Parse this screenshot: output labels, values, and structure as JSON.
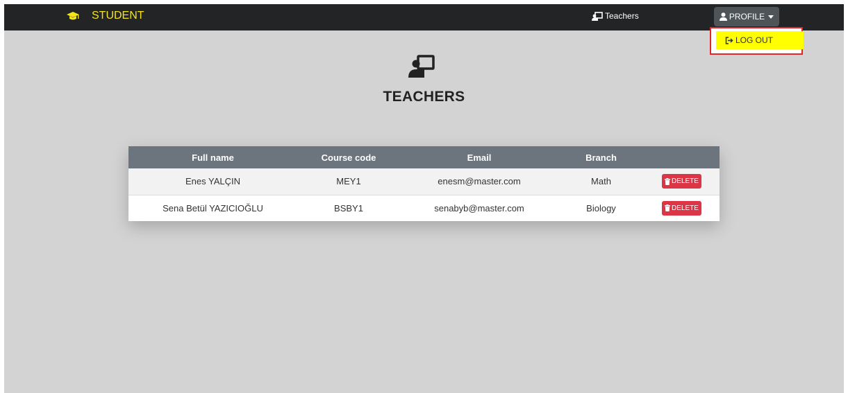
{
  "navbar": {
    "brand_label": "STUDENT",
    "brand_icon": "graduation-cap-icon",
    "teachers_link": "Teachers",
    "profile_label": "PROFILE"
  },
  "dropdown": {
    "logout_label": "LOG OUT"
  },
  "page": {
    "title": "TEACHERS"
  },
  "table": {
    "headers": [
      "Full name",
      "Course code",
      "Email",
      "Branch",
      ""
    ],
    "rows": [
      {
        "name": "Enes YALÇIN",
        "code": "MEY1",
        "email": "enesm@master.com",
        "branch": "Math",
        "action": "DELETE"
      },
      {
        "name": "Sena Betül YAZICIOĞLU",
        "code": "BSBY1",
        "email": "senabyb@master.com",
        "branch": "Biology",
        "action": "DELETE"
      }
    ]
  },
  "colors": {
    "navbar_bg": "#222426",
    "brand": "#f4e51a",
    "highlight": "#ffff00",
    "annotation_border": "#e0252b",
    "table_header": "#6c757d",
    "delete_button": "#dc3545",
    "page_bg": "#d3d3d3"
  }
}
